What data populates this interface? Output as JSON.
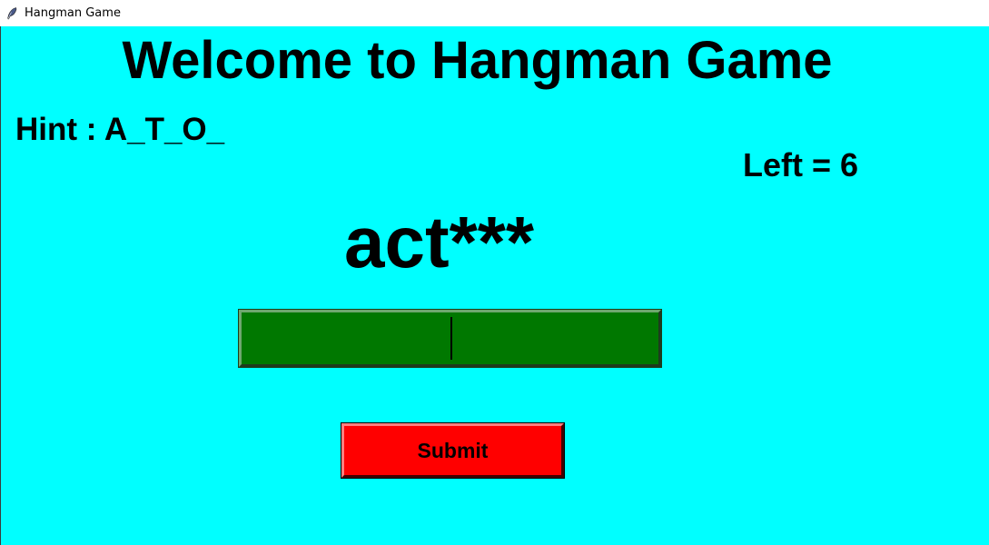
{
  "window": {
    "title": "Hangman Game",
    "icon": "feather-icon"
  },
  "colors": {
    "background": "#00ffff",
    "input_fill": "#007800",
    "button_fill": "#ff0000",
    "text": "#000000"
  },
  "game": {
    "heading": "Welcome to Hangman Game",
    "hint": "Hint : A_T_O_",
    "lives_left": "Left = 6",
    "masked_word": "act***",
    "guess_input_value": "",
    "submit_label": "Submit"
  }
}
